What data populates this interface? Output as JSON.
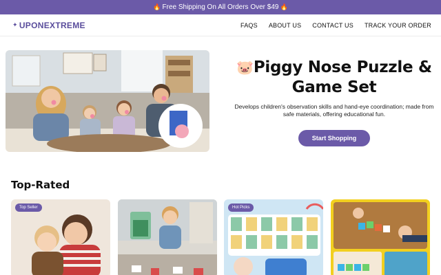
{
  "promo": {
    "text": "Free Shipping On All Orders Over $49"
  },
  "header": {
    "logo": "UPONEXTREME",
    "nav": [
      "FAQS",
      "ABOUT US",
      "CONTACT US",
      "TRACK YOUR ORDER"
    ]
  },
  "hero": {
    "title": "Piggy Nose Puzzle & Game Set",
    "description": "Develops children's observation skills and hand-eye coordination; made from safe materials, offering educational fun.",
    "cta": "Start Shopping"
  },
  "top_rated": {
    "title": "Top-Rated",
    "products": [
      {
        "badge": "Top Seller"
      },
      {
        "badge": ""
      },
      {
        "badge": "Hot Picks"
      },
      {
        "badge": ""
      }
    ]
  },
  "colors": {
    "brand": "#6b5aa8",
    "logo": "#5a4d9c"
  }
}
